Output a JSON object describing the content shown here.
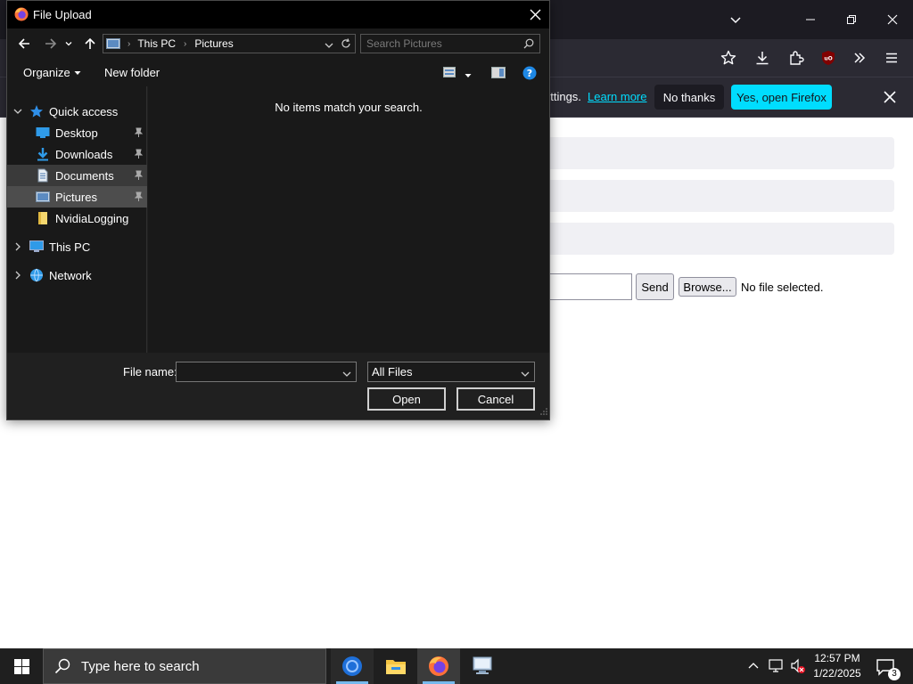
{
  "dialog": {
    "title": "File Upload",
    "breadcrumb": [
      "This PC",
      "Pictures"
    ],
    "search_placeholder": "Search Pictures",
    "organize_label": "Organize",
    "new_folder_label": "New folder",
    "nav": {
      "quick_access": "Quick access",
      "items": [
        "Desktop",
        "Downloads",
        "Documents",
        "Pictures",
        "NvidiaLogging"
      ],
      "this_pc": "This PC",
      "network": "Network"
    },
    "empty_message": "No items match your search.",
    "file_name_label": "File name:",
    "file_name_value": "",
    "file_type": "All Files",
    "open_label": "Open",
    "cancel_label": "Cancel"
  },
  "firefox": {
    "notice_text": "ettings.",
    "notice_link": "Learn more",
    "no_thanks_label": "No thanks",
    "yes_label": "Yes, open Firefox",
    "send_label": "Send",
    "browse_label": "Browse...",
    "no_file_label": "No file selected."
  },
  "taskbar": {
    "search_placeholder": "Type here to search",
    "time": "12:57 PM",
    "date": "1/22/2025",
    "notification_count": "3"
  },
  "colors": {
    "accent": "#00ddff",
    "dialog_bg": "#191919",
    "selected_nav": "#3a3a3a",
    "taskbar_active": "#76b9ed"
  }
}
